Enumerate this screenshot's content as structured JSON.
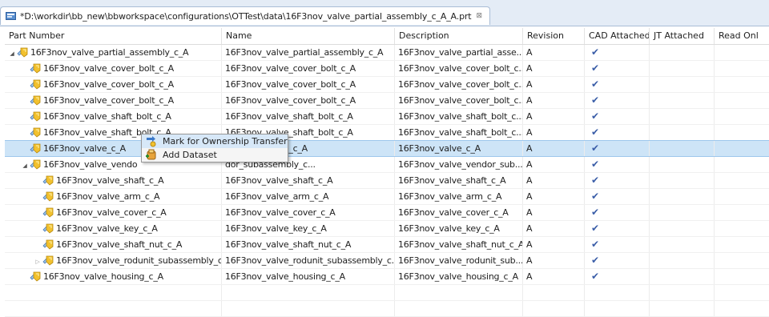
{
  "window": {
    "tab_title": "*D:\\workdir\\bb_new\\bbworkspace\\configurations\\OTTest\\data\\16F3nov_valve_partial_assembly_c_A_A.prt",
    "tab_close": "⊠"
  },
  "table": {
    "columns": [
      "Part Number",
      "Name",
      "Description",
      "Revision",
      "CAD Attached",
      "JT Attached",
      "Read Onl"
    ],
    "rows": [
      {
        "part": "16F3nov_valve_partial_assembly_c_A",
        "name": "16F3nov_valve_partial_assembly_c_A",
        "desc": "16F3nov_valve_partial_asse...",
        "rev": "A",
        "cad": "✔",
        "level": 0,
        "toggle": "expanded"
      },
      {
        "part": "16F3nov_valve_cover_bolt_c_A",
        "name": "16F3nov_valve_cover_bolt_c_A",
        "desc": "16F3nov_valve_cover_bolt_c...",
        "rev": "A",
        "cad": "✔",
        "level": 1,
        "toggle": "none"
      },
      {
        "part": "16F3nov_valve_cover_bolt_c_A",
        "name": "16F3nov_valve_cover_bolt_c_A",
        "desc": "16F3nov_valve_cover_bolt_c...",
        "rev": "A",
        "cad": "✔",
        "level": 1,
        "toggle": "none"
      },
      {
        "part": "16F3nov_valve_cover_bolt_c_A",
        "name": "16F3nov_valve_cover_bolt_c_A",
        "desc": "16F3nov_valve_cover_bolt_c...",
        "rev": "A",
        "cad": "✔",
        "level": 1,
        "toggle": "none"
      },
      {
        "part": "16F3nov_valve_shaft_bolt_c_A",
        "name": "16F3nov_valve_shaft_bolt_c_A",
        "desc": "16F3nov_valve_shaft_bolt_c...",
        "rev": "A",
        "cad": "✔",
        "level": 1,
        "toggle": "none"
      },
      {
        "part": "16F3nov_valve_shaft_bolt_c_A",
        "name": "16F3nov_valve_shaft_bolt_c_A",
        "desc": "16F3nov_valve_shaft_bolt_c...",
        "rev": "A",
        "cad": "✔",
        "level": 1,
        "toggle": "none"
      },
      {
        "part": "16F3nov_valve_c_A",
        "name": "16F3nov_valve_c_A",
        "desc": "16F3nov_valve_c_A",
        "rev": "A",
        "cad": "✔",
        "level": 1,
        "toggle": "none",
        "selected": true
      },
      {
        "part": "16F3nov_valve_vendo",
        "name": "dor_subassembly_c...",
        "desc": "16F3nov_valve_vendor_sub...",
        "rev": "A",
        "cad": "✔",
        "level": 1,
        "toggle": "expanded"
      },
      {
        "part": "16F3nov_valve_shaft_c_A",
        "name": "16F3nov_valve_shaft_c_A",
        "desc": "16F3nov_valve_shaft_c_A",
        "rev": "A",
        "cad": "✔",
        "level": 2,
        "toggle": "none"
      },
      {
        "part": "16F3nov_valve_arm_c_A",
        "name": "16F3nov_valve_arm_c_A",
        "desc": "16F3nov_valve_arm_c_A",
        "rev": "A",
        "cad": "✔",
        "level": 2,
        "toggle": "none"
      },
      {
        "part": "16F3nov_valve_cover_c_A",
        "name": "16F3nov_valve_cover_c_A",
        "desc": "16F3nov_valve_cover_c_A",
        "rev": "A",
        "cad": "✔",
        "level": 2,
        "toggle": "none"
      },
      {
        "part": "16F3nov_valve_key_c_A",
        "name": "16F3nov_valve_key_c_A",
        "desc": "16F3nov_valve_key_c_A",
        "rev": "A",
        "cad": "✔",
        "level": 2,
        "toggle": "none"
      },
      {
        "part": "16F3nov_valve_shaft_nut_c_A",
        "name": "16F3nov_valve_shaft_nut_c_A",
        "desc": "16F3nov_valve_shaft_nut_c_A",
        "rev": "A",
        "cad": "✔",
        "level": 2,
        "toggle": "none"
      },
      {
        "part": "16F3nov_valve_rodunit_subassembly_c",
        "name": "16F3nov_valve_rodunit_subassembly_c...",
        "desc": "16F3nov_valve_rodunit_sub...",
        "rev": "A",
        "cad": "✔",
        "level": 2,
        "toggle": "collapsed"
      },
      {
        "part": "16F3nov_valve_housing_c_A",
        "name": "16F3nov_valve_housing_c_A",
        "desc": "16F3nov_valve_housing_c_A",
        "rev": "A",
        "cad": "✔",
        "level": 1,
        "toggle": "none"
      }
    ]
  },
  "context_menu": {
    "items": [
      {
        "label": "Mark for Ownership Transfer",
        "icon": "ownership-transfer-icon"
      },
      {
        "label": "Add Dataset",
        "icon": "add-dataset-icon"
      }
    ]
  },
  "colors": {
    "selection": "#cde4f7",
    "check": "#3b5ea8",
    "part_icon": "#f2c12e"
  }
}
